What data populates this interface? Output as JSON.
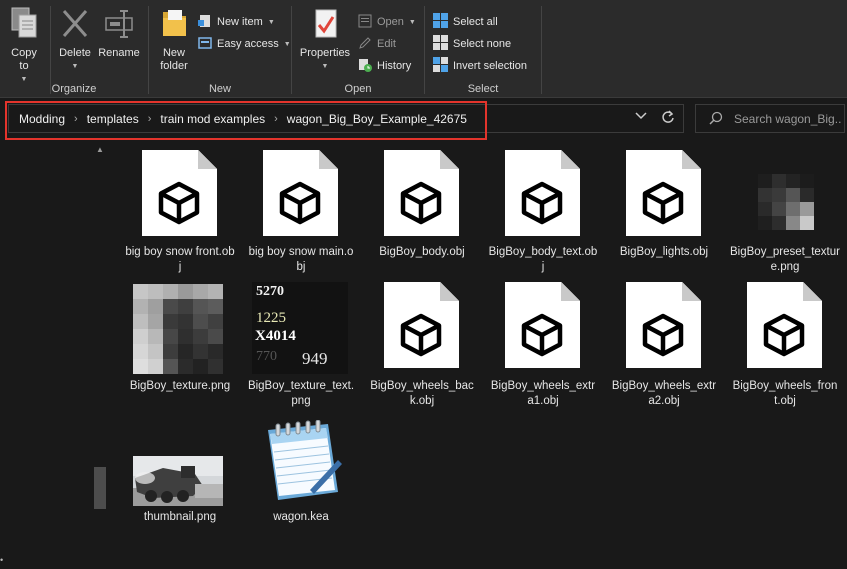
{
  "ribbon": {
    "organize": {
      "label": "Organize",
      "copy_to": "Copy to",
      "delete": "Delete",
      "rename": "Rename"
    },
    "new": {
      "label": "New",
      "new_folder": "New folder",
      "new_item": "New item",
      "easy_access": "Easy access"
    },
    "open": {
      "label": "Open",
      "properties": "Properties",
      "open": "Open",
      "edit": "Edit",
      "history": "History"
    },
    "select": {
      "label": "Select",
      "select_all": "Select all",
      "select_none": "Select none",
      "invert_selection": "Invert selection"
    }
  },
  "address": {
    "crumbs": [
      "Modding",
      "templates",
      "train mod examples",
      "wagon_Big_Boy_Example_42675"
    ],
    "highlight_color": "#e3342c"
  },
  "search": {
    "placeholder": "Search wagon_Big..."
  },
  "files": [
    {
      "name": "big boy snow front.obj",
      "type": "obj"
    },
    {
      "name": "big boy snow main.obj",
      "type": "obj"
    },
    {
      "name": "BigBoy_body.obj",
      "type": "obj"
    },
    {
      "name": "BigBoy_body_text.obj",
      "type": "obj"
    },
    {
      "name": "BigBoy_lights.obj",
      "type": "obj"
    },
    {
      "name": "BigBoy_preset_texture.png",
      "type": "png-pixels"
    },
    {
      "name": "BigBoy_texture.png",
      "type": "png-grey"
    },
    {
      "name": "BigBoy_texture_text.png",
      "type": "png-numbers",
      "thumb_text": [
        "5270",
        "1225",
        "X4014",
        "770",
        "949"
      ]
    },
    {
      "name": "BigBoy_wheels_back.obj",
      "type": "obj"
    },
    {
      "name": "BigBoy_wheels_extra1.obj",
      "type": "obj"
    },
    {
      "name": "BigBoy_wheels_extra2.obj",
      "type": "obj"
    },
    {
      "name": "BigBoy_wheels_front.obj",
      "type": "obj"
    },
    {
      "name": "thumbnail.png",
      "type": "png-photo"
    },
    {
      "name": "wagon.kea",
      "type": "notepad"
    }
  ]
}
